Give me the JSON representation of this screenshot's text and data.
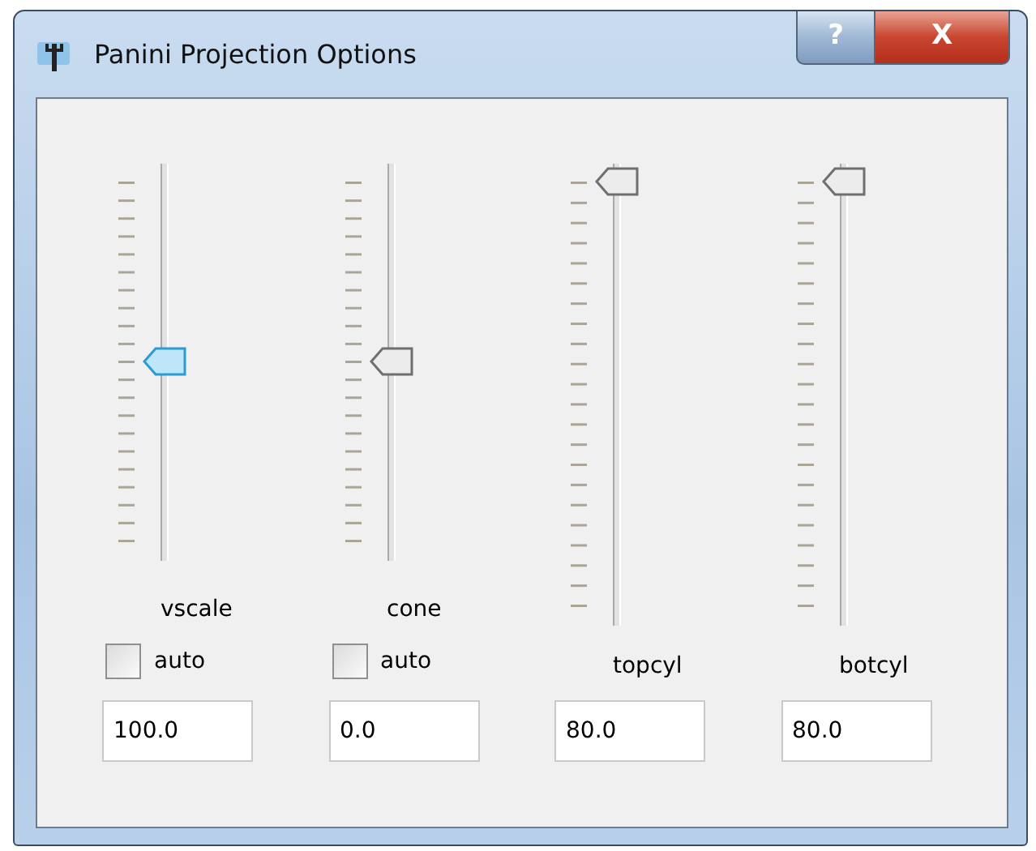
{
  "window": {
    "title": "Panini Projection Options",
    "buttons": [
      {
        "kind": "help",
        "label": "?"
      },
      {
        "kind": "close",
        "label": "X"
      }
    ]
  },
  "controls": [
    {
      "label": "vscale",
      "level": 0.5,
      "focused": true,
      "auto": {
        "label": "auto",
        "checked": false
      },
      "value": "100.0"
    },
    {
      "label": "cone",
      "level": 0.5,
      "focused": false,
      "auto": {
        "label": "auto",
        "checked": false
      },
      "value": "0.0"
    },
    {
      "label": "topcyl",
      "level": 1,
      "focused": false,
      "value": "80.0"
    },
    {
      "label": "botcyl",
      "level": 1,
      "focused": false,
      "value": "80.0"
    }
  ]
}
